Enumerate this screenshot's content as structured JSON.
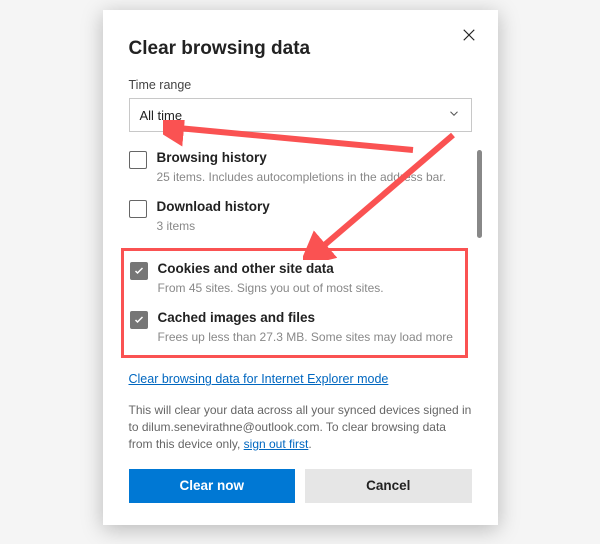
{
  "dialog": {
    "title": "Clear browsing data",
    "time_range_label": "Time range",
    "time_range_value": "All time",
    "options": [
      {
        "title": "Browsing history",
        "desc": "25 items. Includes autocompletions in the address bar.",
        "checked": false
      },
      {
        "title": "Download history",
        "desc": "3 items",
        "checked": false
      },
      {
        "title": "Cookies and other site data",
        "desc": "From 45 sites. Signs you out of most sites.",
        "checked": true
      },
      {
        "title": "Cached images and files",
        "desc": "Frees up less than 27.3 MB. Some sites may load more",
        "checked": true
      }
    ],
    "ie_link": "Clear browsing data for Internet Explorer mode",
    "footer_prefix": "This will clear your data across all your synced devices signed in to ",
    "footer_email": "dilum.senevirathne@outlook.com",
    "footer_mid": ". To clear browsing data from this device only, ",
    "footer_link": "sign out first",
    "footer_suffix": ".",
    "clear_btn": "Clear now",
    "cancel_btn": "Cancel"
  }
}
